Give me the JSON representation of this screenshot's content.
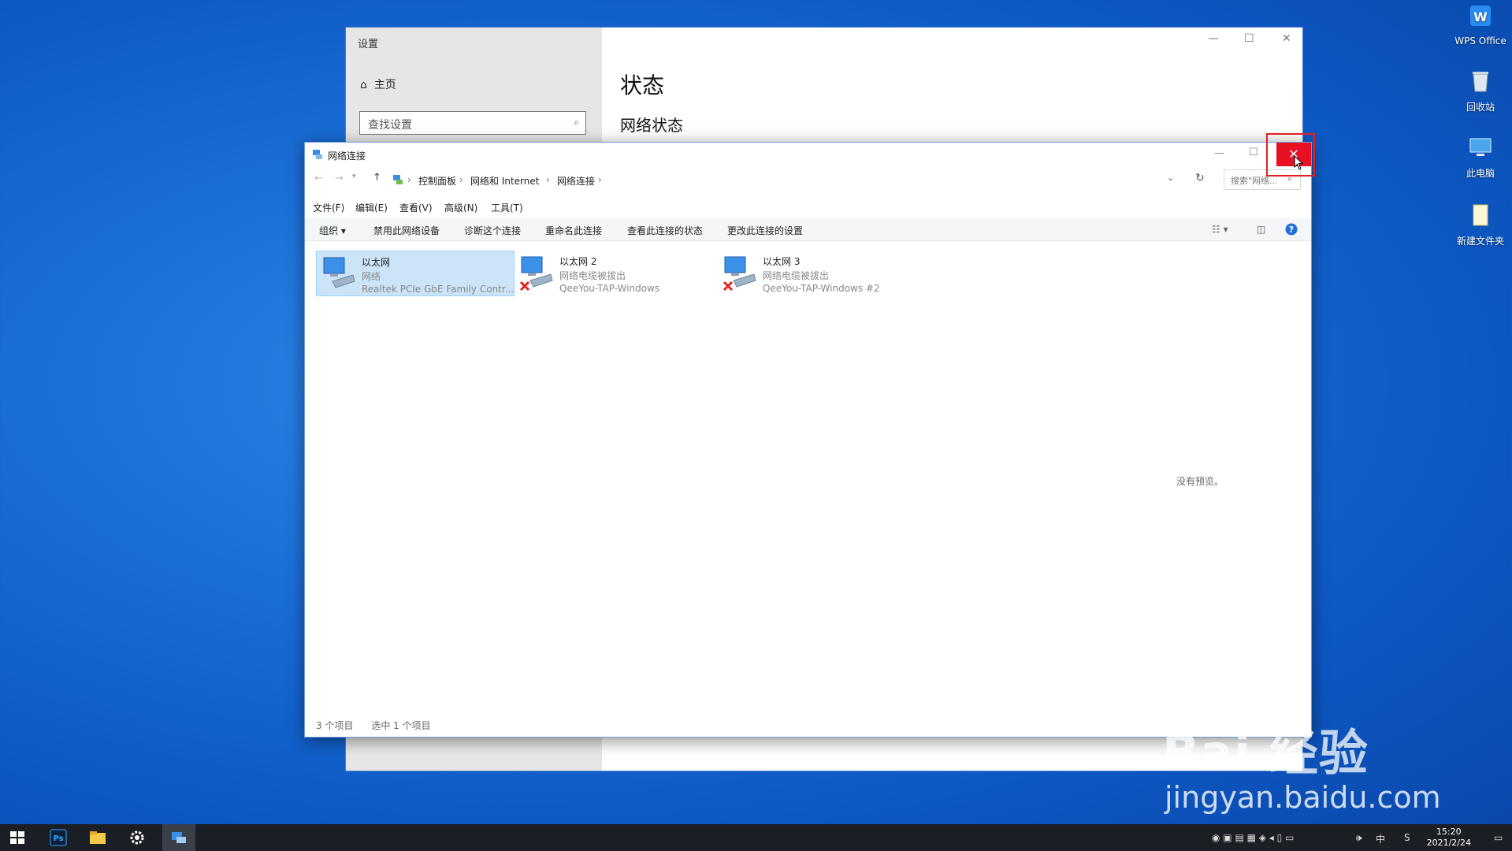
{
  "desktop": {
    "icons": [
      {
        "label": "WPS Office",
        "icon": "wps-office-icon"
      },
      {
        "label": "回收站",
        "icon": "recycle-bin-icon"
      },
      {
        "label": "此电脑",
        "icon": "this-pc-icon"
      },
      {
        "label": "新建文件夹",
        "icon": "folder-icon"
      }
    ]
  },
  "settings": {
    "title": "设置",
    "home_label": "主页",
    "search_placeholder": "查找设置",
    "heading": "状态",
    "subheading": "网络状态"
  },
  "network_window": {
    "title": "网络连接",
    "breadcrumb": [
      "控制面板",
      "网络和 Internet",
      "网络连接"
    ],
    "search_placeholder": "搜索\"网络...",
    "menu": [
      "文件(F)",
      "编辑(E)",
      "查看(V)",
      "高级(N)",
      "工具(T)"
    ],
    "commands": [
      "组织 ▾",
      "禁用此网络设备",
      "诊断这个连接",
      "重命名此连接",
      "查看此连接的状态",
      "更改此连接的设置"
    ],
    "items": [
      {
        "name": "以太网",
        "status": "网络",
        "adapter": "Realtek PCIe GbE Family Contr...",
        "selected": true,
        "disconnected": false
      },
      {
        "name": "以太网 2",
        "status": "网络电缆被拔出",
        "adapter": "QeeYou-TAP-Windows",
        "selected": false,
        "disconnected": true
      },
      {
        "name": "以太网 3",
        "status": "网络电缆被拔出",
        "adapter": "QeeYou-TAP-Windows #2",
        "selected": false,
        "disconnected": true
      }
    ],
    "no_preview": "没有预览。",
    "status_count": "3 个项目",
    "status_selected": "选中 1 个项目"
  },
  "taskbar": {
    "ime": "中",
    "time": "15:20",
    "date": "2021/2/24"
  },
  "watermark": {
    "brand": "Bai 经验",
    "url": "jingyan.baidu.com"
  },
  "colors": {
    "desktop_blue": "#1a6fd6",
    "close_red": "#e81123",
    "selection": "#cce4f7",
    "highlight_box": "#e02020"
  }
}
